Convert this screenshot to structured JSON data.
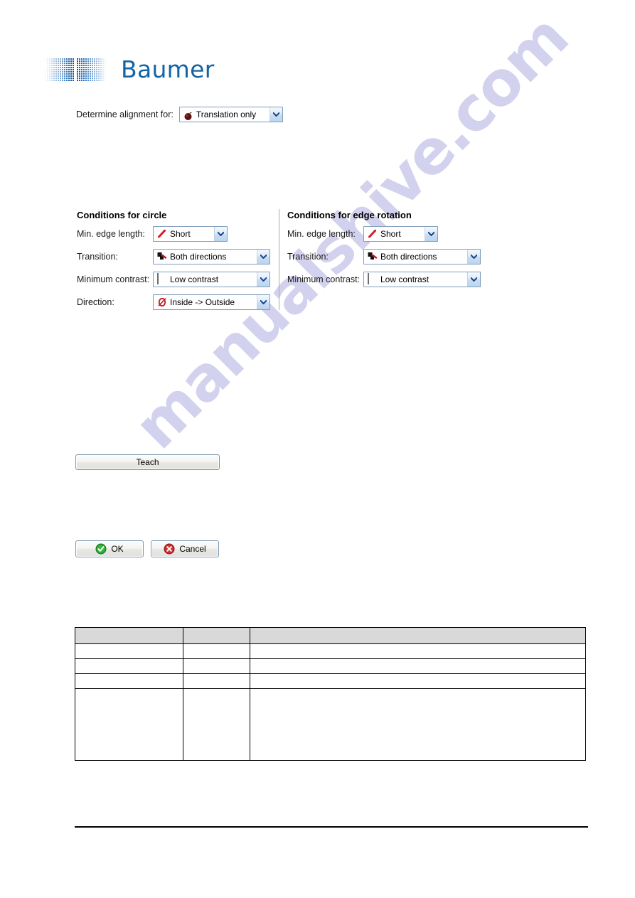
{
  "brand": {
    "name": "Baumer",
    "logo_color": "#1464a5"
  },
  "watermark": {
    "text": "manualshive.com",
    "color": "#b9b8e4"
  },
  "alignment": {
    "label": "Determine alignment for:",
    "value": "Translation only",
    "icon": "translation-icon"
  },
  "circle_group": {
    "title": "Conditions for circle",
    "fields": [
      {
        "label": "Min. edge length:",
        "value": "Short",
        "icon": "edge-length-icon"
      },
      {
        "label": "Transition:",
        "value": "Both directions",
        "icon": "transition-icon"
      },
      {
        "label": "Minimum contrast:",
        "value": "Low contrast",
        "icon": "contrast-icon"
      },
      {
        "label": "Direction:",
        "value": "Inside -> Outside",
        "icon": "direction-icon"
      }
    ]
  },
  "edge_rotation_group": {
    "title": "Conditions for edge rotation",
    "fields": [
      {
        "label": "Min. edge length:",
        "value": "Short",
        "icon": "edge-length-icon"
      },
      {
        "label": "Transition:",
        "value": "Both directions",
        "icon": "transition-icon"
      },
      {
        "label": "Minimum contrast:",
        "value": "Low contrast",
        "icon": "contrast-icon"
      }
    ]
  },
  "buttons": {
    "teach": "Teach",
    "ok": "OK",
    "cancel": "Cancel",
    "ok_icon_color": "#2aa832",
    "cancel_icon_color": "#c72b2b"
  },
  "table": {
    "header": [
      "",
      "",
      ""
    ],
    "rows": [
      {
        "cells": [
          "",
          "",
          ""
        ],
        "tall": false
      },
      {
        "cells": [
          "",
          "",
          ""
        ],
        "tall": false
      },
      {
        "cells": [
          "",
          "",
          ""
        ],
        "tall": false
      },
      {
        "cells": [
          "",
          "",
          ""
        ],
        "tall": true
      }
    ]
  }
}
